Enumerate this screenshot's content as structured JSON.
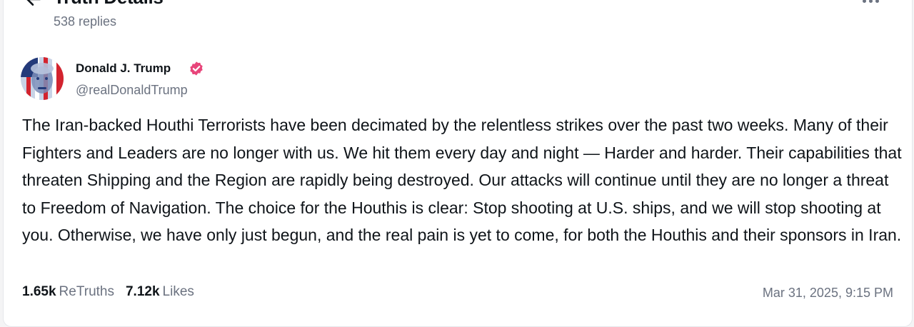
{
  "header": {
    "title": "Truth Details",
    "replies": "538 replies"
  },
  "post": {
    "author": {
      "name": "Donald J. Trump",
      "handle": "@realDonaldTrump",
      "verified": true
    },
    "body": "The Iran-backed Houthi Terrorists have been decimated by the relentless strikes over the past two weeks. Many of their Fighters and Leaders are no longer with us. We hit them every day and night — Harder and harder. Their capabilities that threaten Shipping and the Region are rapidly being destroyed. Our attacks will continue until they are no longer a threat to Freedom of Navigation. The choice for the Houthis is clear: Stop shooting at U.S. ships, and we will stop shooting at you. Otherwise, we have only just begun, and the real pain is yet to come, for both the Houthis and their sponsors in Iran.",
    "retruths_count": "1.65k",
    "retruths_label": "ReTruths",
    "likes_count": "7.12k",
    "likes_label": "Likes",
    "timestamp": "Mar 31, 2025, 9:15 PM"
  },
  "colors": {
    "verified_badge": "#e8457a",
    "muted_text": "#6b7280",
    "primary_text": "#0f1419"
  },
  "icons": {
    "back": "arrow-left-icon",
    "more": "more-horizontal-icon",
    "verified": "verified-badge-icon"
  }
}
